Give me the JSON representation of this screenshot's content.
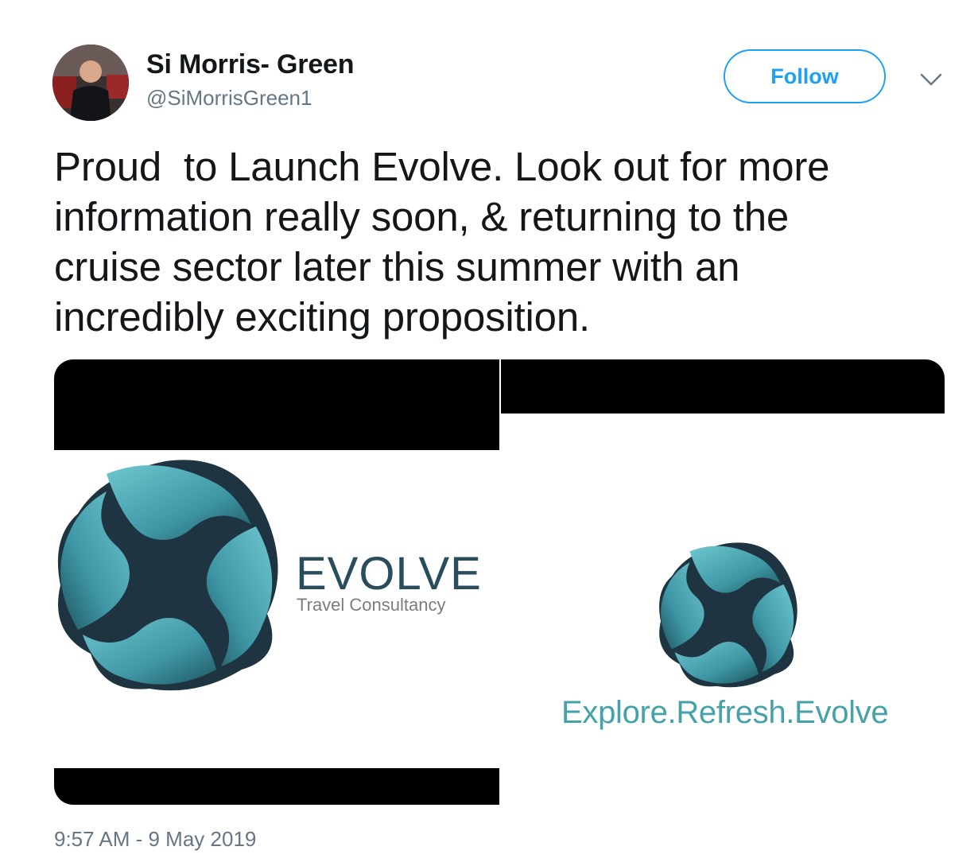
{
  "author": {
    "display_name": "Si Morris- Green",
    "handle": "@SiMorrisGreen1"
  },
  "actions": {
    "follow_label": "Follow",
    "more_icon": "chevron-down-icon"
  },
  "tweet": {
    "text": "Proud  to Launch Evolve. Look out for more\ninformation really soon, & returning to the\ncruise sector later this summer with an\nincredibly exciting proposition.",
    "timestamp": "9:57 AM - 9 May 2019"
  },
  "media": {
    "left_image": {
      "brand_name": "EVOLVE",
      "brand_subtitle": "Travel Consultancy"
    },
    "right_image": {
      "tagline": "Explore.Refresh.Evolve"
    }
  },
  "colors": {
    "accent": "#1da1f2",
    "logo_teal": "#4aa8b6",
    "logo_dark": "#1e3440",
    "tagline_teal": "#45a2a8"
  }
}
